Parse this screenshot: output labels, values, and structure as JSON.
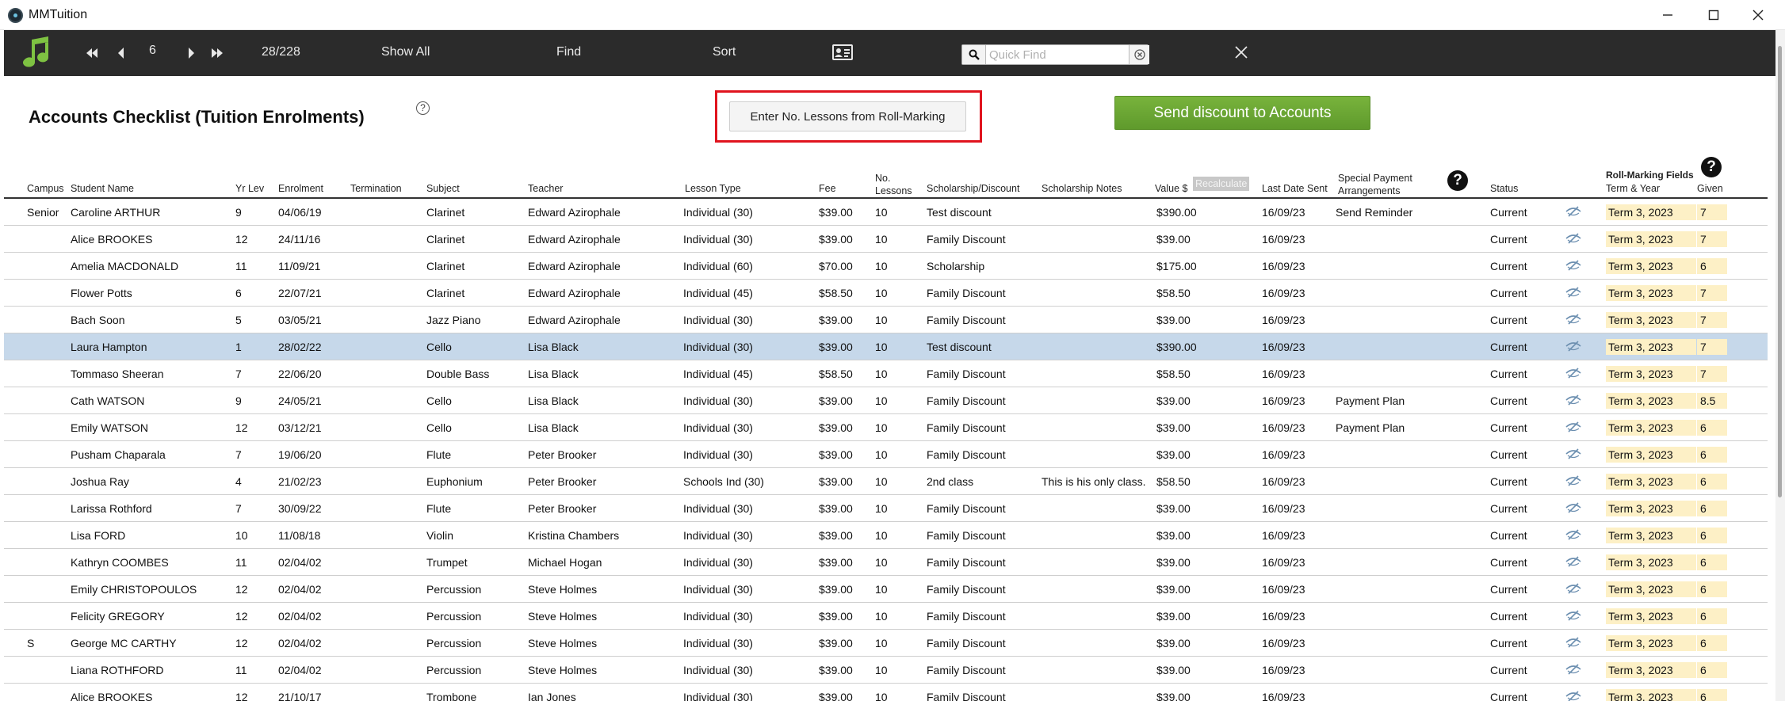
{
  "window": {
    "title": "MMTuition"
  },
  "toolbar": {
    "record_number": "6",
    "record_count": "28/228",
    "show_all": "Show All",
    "find": "Find",
    "sort": "Sort",
    "quick_find_placeholder": "Quick Find"
  },
  "page": {
    "title": "Accounts Checklist (Tuition Enrolments)",
    "help_small": "?",
    "enter_lessons_label": "Enter No. Lessons from Roll-Marking",
    "send_discount_label": "Send discount to Accounts"
  },
  "columns": {
    "campus": "Campus",
    "student": "Student Name",
    "yr": "Yr Lev",
    "enrolment": "Enrolment",
    "termination": "Termination",
    "subject": "Subject",
    "teacher": "Teacher",
    "lesson_type": "Lesson Type",
    "fee": "Fee",
    "no_lessons_1": "No.",
    "no_lessons_2": "Lessons",
    "scholarship": "Scholarship/Discount",
    "sch_notes": "Scholarship Notes",
    "value": "Value $",
    "recalculate": "Recalculate",
    "last_date": "Last Date Sent",
    "special_1": "Special Payment",
    "special_2": "Arrangements",
    "status": "Status",
    "roll_marking": "Roll-Marking Fields",
    "term_year": "Term & Year",
    "given": "Given",
    "help": "?"
  },
  "rows": [
    {
      "campus": "Senior",
      "student": "Caroline ARTHUR",
      "yr": "9",
      "enrolment": "04/06/19",
      "subject": "Clarinet",
      "teacher": "Edward Azirophale",
      "lesson_type": "Individual (30)",
      "fee": "$39.00",
      "lessons": "10",
      "discount": "Test discount",
      "notes": "",
      "value": "$390.00",
      "last_sent": "16/09/23",
      "special": "Send Reminder",
      "status": "Current",
      "term": "Term 3, 2023",
      "given": "7"
    },
    {
      "campus": "",
      "student": "Alice BROOKES",
      "yr": "12",
      "enrolment": "24/11/16",
      "subject": "Clarinet",
      "teacher": "Edward Azirophale",
      "lesson_type": "Individual (30)",
      "fee": "$39.00",
      "lessons": "10",
      "discount": "Family Discount",
      "notes": "",
      "value": "$39.00",
      "last_sent": "16/09/23",
      "special": "",
      "status": "Current",
      "term": "Term 3, 2023",
      "given": "7"
    },
    {
      "campus": "",
      "student": "Amelia MACDONALD",
      "yr": "11",
      "enrolment": "11/09/21",
      "subject": "Clarinet",
      "teacher": "Edward Azirophale",
      "lesson_type": "Individual (60)",
      "fee": "$70.00",
      "lessons": "10",
      "discount": "Scholarship",
      "notes": "",
      "value": "$175.00",
      "last_sent": "16/09/23",
      "special": "",
      "status": "Current",
      "term": "Term 3, 2023",
      "given": "6"
    },
    {
      "campus": "",
      "student": "Flower Potts",
      "yr": "6",
      "enrolment": "22/07/21",
      "subject": "Clarinet",
      "teacher": "Edward Azirophale",
      "lesson_type": "Individual (45)",
      "fee": "$58.50",
      "lessons": "10",
      "discount": "Family Discount",
      "notes": "",
      "value": "$58.50",
      "last_sent": "16/09/23",
      "special": "",
      "status": "Current",
      "term": "Term 3, 2023",
      "given": "7"
    },
    {
      "campus": "",
      "student": "Bach Soon",
      "yr": "5",
      "enrolment": "03/05/21",
      "subject": "Jazz Piano",
      "teacher": "Edward Azirophale",
      "lesson_type": "Individual (30)",
      "fee": "$39.00",
      "lessons": "10",
      "discount": "Family Discount",
      "notes": "",
      "value": "$39.00",
      "last_sent": "16/09/23",
      "special": "",
      "status": "Current",
      "term": "Term 3, 2023",
      "given": "7"
    },
    {
      "campus": "",
      "student": "Laura Hampton",
      "yr": "1",
      "enrolment": "28/02/22",
      "subject": "Cello",
      "teacher": "Lisa Black",
      "lesson_type": "Individual (30)",
      "fee": "$39.00",
      "lessons": "10",
      "discount": "Test discount",
      "notes": "",
      "value": "$390.00",
      "last_sent": "16/09/23",
      "special": "",
      "status": "Current",
      "term": "Term 3, 2023",
      "given": "7"
    },
    {
      "campus": "",
      "student": "Tommaso Sheeran",
      "yr": "7",
      "enrolment": "22/06/20",
      "subject": "Double Bass",
      "teacher": "Lisa Black",
      "lesson_type": "Individual (45)",
      "fee": "$58.50",
      "lessons": "10",
      "discount": "Family Discount",
      "notes": "",
      "value": "$58.50",
      "last_sent": "16/09/23",
      "special": "",
      "status": "Current",
      "term": "Term 3, 2023",
      "given": "7"
    },
    {
      "campus": "",
      "student": "Cath WATSON",
      "yr": "9",
      "enrolment": "24/05/21",
      "subject": "Cello",
      "teacher": "Lisa Black",
      "lesson_type": "Individual (30)",
      "fee": "$39.00",
      "lessons": "10",
      "discount": "Family Discount",
      "notes": "",
      "value": "$39.00",
      "last_sent": "16/09/23",
      "special": "Payment Plan",
      "status": "Current",
      "term": "Term 3, 2023",
      "given": "8.5"
    },
    {
      "campus": "",
      "student": "Emily WATSON",
      "yr": "12",
      "enrolment": "03/12/21",
      "subject": "Cello",
      "teacher": "Lisa Black",
      "lesson_type": "Individual (30)",
      "fee": "$39.00",
      "lessons": "10",
      "discount": "Family Discount",
      "notes": "",
      "value": "$39.00",
      "last_sent": "16/09/23",
      "special": "Payment Plan",
      "status": "Current",
      "term": "Term 3, 2023",
      "given": "6"
    },
    {
      "campus": "",
      "student": "Pusham Chaparala",
      "yr": "7",
      "enrolment": "19/06/20",
      "subject": "Flute",
      "teacher": "Peter Brooker",
      "lesson_type": "Individual (30)",
      "fee": "$39.00",
      "lessons": "10",
      "discount": "Family Discount",
      "notes": "",
      "value": "$39.00",
      "last_sent": "16/09/23",
      "special": "",
      "status": "Current",
      "term": "Term 3, 2023",
      "given": "6"
    },
    {
      "campus": "",
      "student": "Joshua Ray",
      "yr": "4",
      "enrolment": "21/02/23",
      "subject": "Euphonium",
      "teacher": "Peter Brooker",
      "lesson_type": "Schools Ind (30)",
      "fee": "$39.00",
      "lessons": "10",
      "discount": "2nd class",
      "notes": "This is his only class.",
      "value": "$58.50",
      "last_sent": "16/09/23",
      "special": "",
      "status": "Current",
      "term": "Term 3, 2023",
      "given": "6"
    },
    {
      "campus": "",
      "student": "Larissa Rothford",
      "yr": "7",
      "enrolment": "30/09/22",
      "subject": "Flute",
      "teacher": "Peter Brooker",
      "lesson_type": "Individual (30)",
      "fee": "$39.00",
      "lessons": "10",
      "discount": "Family Discount",
      "notes": "",
      "value": "$39.00",
      "last_sent": "16/09/23",
      "special": "",
      "status": "Current",
      "term": "Term 3, 2023",
      "given": "6"
    },
    {
      "campus": "",
      "student": "Lisa FORD",
      "yr": "10",
      "enrolment": "11/08/18",
      "subject": "Violin",
      "teacher": "Kristina Chambers",
      "lesson_type": "Individual (30)",
      "fee": "$39.00",
      "lessons": "10",
      "discount": "Family Discount",
      "notes": "",
      "value": "$39.00",
      "last_sent": "16/09/23",
      "special": "",
      "status": "Current",
      "term": "Term 3, 2023",
      "given": "6"
    },
    {
      "campus": "",
      "student": "Kathryn COOMBES",
      "yr": "11",
      "enrolment": "02/04/02",
      "subject": "Trumpet",
      "teacher": "Michael Hogan",
      "lesson_type": "Individual (30)",
      "fee": "$39.00",
      "lessons": "10",
      "discount": "Family Discount",
      "notes": "",
      "value": "$39.00",
      "last_sent": "16/09/23",
      "special": "",
      "status": "Current",
      "term": "Term 3, 2023",
      "given": "6"
    },
    {
      "campus": "",
      "student": "Emily CHRISTOPOULOS",
      "yr": "12",
      "enrolment": "02/04/02",
      "subject": "Percussion",
      "teacher": "Steve Holmes",
      "lesson_type": "Individual (30)",
      "fee": "$39.00",
      "lessons": "10",
      "discount": "Family Discount",
      "notes": "",
      "value": "$39.00",
      "last_sent": "16/09/23",
      "special": "",
      "status": "Current",
      "term": "Term 3, 2023",
      "given": "6"
    },
    {
      "campus": "",
      "student": "Felicity GREGORY",
      "yr": "12",
      "enrolment": "02/04/02",
      "subject": "Percussion",
      "teacher": "Steve Holmes",
      "lesson_type": "Individual (30)",
      "fee": "$39.00",
      "lessons": "10",
      "discount": "Family Discount",
      "notes": "",
      "value": "$39.00",
      "last_sent": "16/09/23",
      "special": "",
      "status": "Current",
      "term": "Term 3, 2023",
      "given": "6"
    },
    {
      "campus": "S",
      "student": "George MC CARTHY",
      "yr": "12",
      "enrolment": "02/04/02",
      "subject": "Percussion",
      "teacher": "Steve Holmes",
      "lesson_type": "Individual (30)",
      "fee": "$39.00",
      "lessons": "10",
      "discount": "Family Discount",
      "notes": "",
      "value": "$39.00",
      "last_sent": "16/09/23",
      "special": "",
      "status": "Current",
      "term": "Term 3, 2023",
      "given": "6"
    },
    {
      "campus": "",
      "student": "Liana ROTHFORD",
      "yr": "11",
      "enrolment": "02/04/02",
      "subject": "Percussion",
      "teacher": "Steve Holmes",
      "lesson_type": "Individual (30)",
      "fee": "$39.00",
      "lessons": "10",
      "discount": "Family Discount",
      "notes": "",
      "value": "$39.00",
      "last_sent": "16/09/23",
      "special": "",
      "status": "Current",
      "term": "Term 3, 2023",
      "given": "6"
    },
    {
      "campus": "",
      "student": "Alice BROOKES",
      "yr": "12",
      "enrolment": "21/10/17",
      "subject": "Trombone",
      "teacher": "Ian Jones",
      "lesson_type": "Individual (30)",
      "fee": "$39.00",
      "lessons": "10",
      "discount": "Family Discount",
      "notes": "",
      "value": "$39.00",
      "last_sent": "16/09/23",
      "special": "",
      "status": "Current",
      "term": "Term 3, 2023",
      "given": "6"
    }
  ],
  "selected_row": 5,
  "colors": {
    "toolbar_bg": "#2b2b2b",
    "accent_green": "#6aa532",
    "highlight_red": "#e0141e",
    "selected_row": "#c6d8ea",
    "chip_bg": "#fdf0c6"
  },
  "icons": [
    "app-icon",
    "music-note-icon",
    "first-record-icon",
    "prev-record-icon",
    "next-record-icon",
    "last-record-icon",
    "contact-card-icon",
    "search-icon",
    "clear-circle-icon",
    "close-icon",
    "eye-off-icon",
    "help-icon"
  ]
}
